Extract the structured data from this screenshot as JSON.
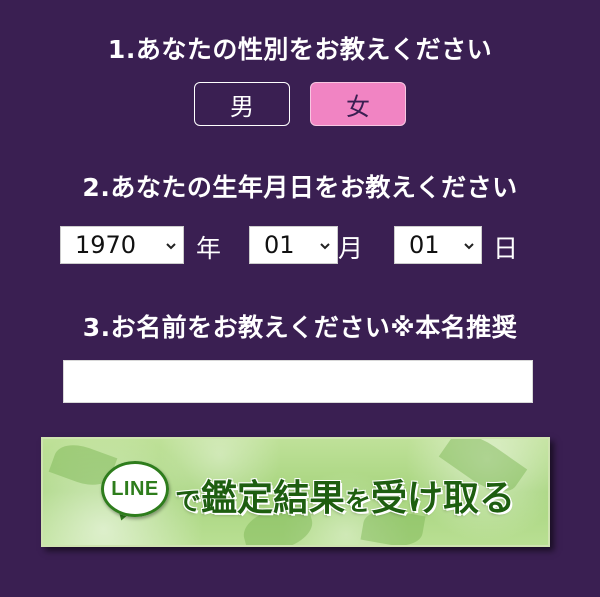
{
  "questions": {
    "q1": "1.あなたの性別をお教えください",
    "q2": "2.あなたの生年月日をお教えください",
    "q3": "3.お名前をお教えください※本名推奨"
  },
  "gender": {
    "male": "男",
    "female": "女",
    "selected": "female"
  },
  "birthdate": {
    "year": "1970",
    "year_unit": "年",
    "month": "01",
    "month_unit": "月",
    "day": "01",
    "day_unit": "日"
  },
  "name_input": {
    "value": "",
    "placeholder": ""
  },
  "line_banner": {
    "logo_text": "LINE",
    "lead": "で",
    "text": "鑑定結果",
    "particle": "を",
    "tail": "受け取る"
  },
  "colors": {
    "background": "#3a1f52",
    "female_selected": "#f184c3",
    "line_green": "#2e7d1c"
  }
}
